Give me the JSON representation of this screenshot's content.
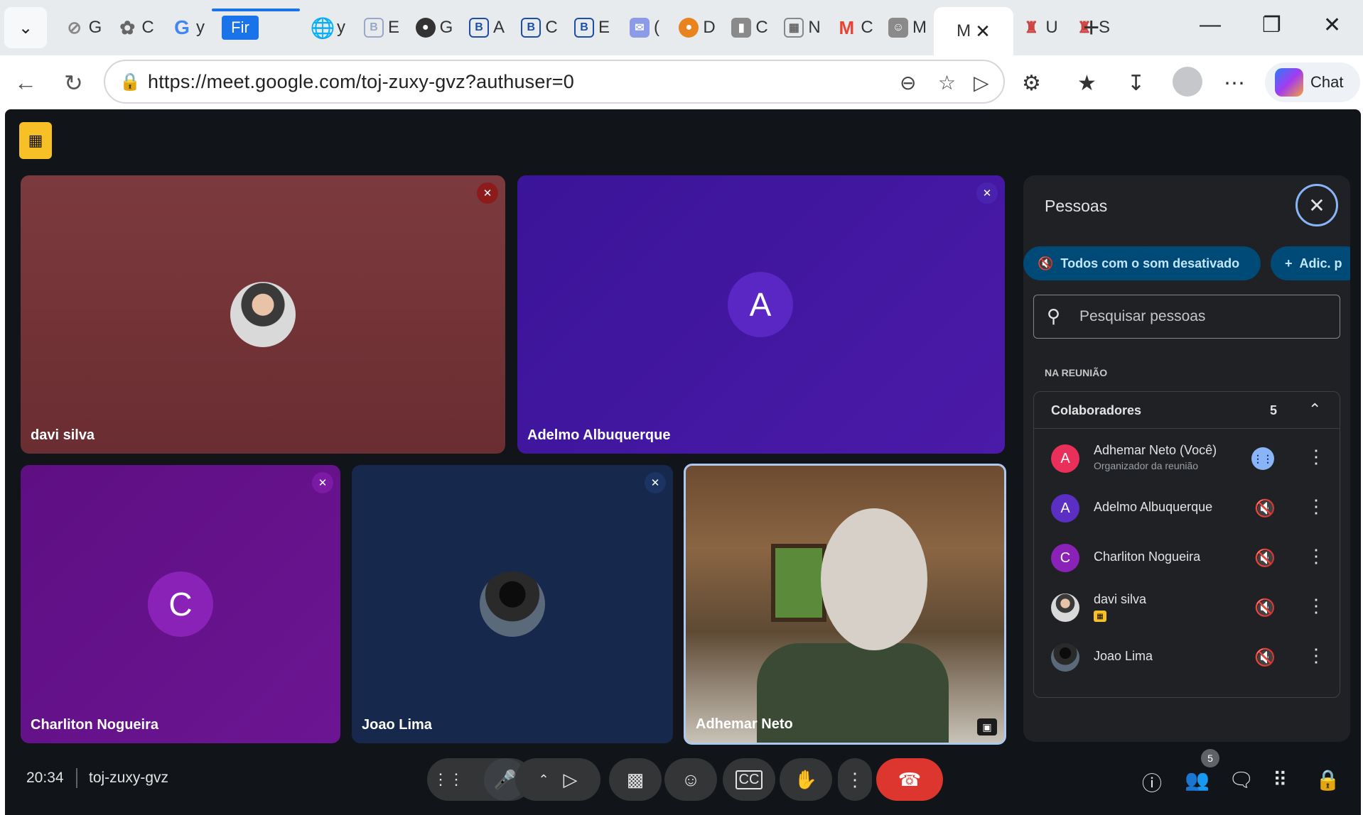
{
  "browser": {
    "tabs": [
      {
        "letter": "G",
        "icon": "feather-icon"
      },
      {
        "letter": "C",
        "icon": "openai-icon"
      },
      {
        "letter": "y",
        "icon": "google-icon"
      },
      {
        "label": "Fir",
        "icon": "fir-icon"
      },
      {
        "letter": "y",
        "icon": "globe-icon"
      },
      {
        "letter": "E",
        "icon": "b-icon"
      },
      {
        "letter": "G",
        "icon": "github-icon"
      },
      {
        "letter": "A",
        "icon": "b-icon"
      },
      {
        "letter": "C",
        "icon": "b-icon"
      },
      {
        "letter": "E",
        "icon": "b-icon"
      },
      {
        "letter": "(",
        "icon": "mail-icon"
      },
      {
        "letter": "D",
        "icon": "metamask-icon"
      },
      {
        "letter": "C",
        "icon": "book-icon"
      },
      {
        "letter": "N",
        "icon": "app-icon"
      },
      {
        "letter": "C",
        "icon": "gmail-icon"
      },
      {
        "letter": "M",
        "icon": "contact-icon"
      },
      {
        "letter": "U",
        "icon": "castle-icon"
      },
      {
        "letter": "S",
        "icon": "castle-icon"
      }
    ],
    "active_tab_letter": "M",
    "url": "https://meet.google.com/toj-zuxy-gvz?authuser=0",
    "chat_label": "Chat"
  },
  "meet": {
    "tiles": [
      {
        "name": "davi silva"
      },
      {
        "name": "Adelmo Albuquerque",
        "initial": "A"
      },
      {
        "name": "Charliton Nogueira",
        "initial": "C"
      },
      {
        "name": "Joao Lima"
      },
      {
        "name": "Adhemar Neto"
      }
    ],
    "panel": {
      "title": "Pessoas",
      "mute_all": "Todos com o som desativado",
      "add": "Adic. p",
      "search_placeholder": "Pesquisar pessoas",
      "section": "NA REUNIÃO",
      "group_title": "Colaboradores",
      "group_count": "5",
      "people": [
        {
          "name": "Adhemar Neto (Você)",
          "sub": "Organizador da reunião",
          "initial": "A",
          "color": "#e8305a"
        },
        {
          "name": "Adelmo Albuquerque",
          "initial": "A",
          "color": "#5b2fc4"
        },
        {
          "name": "Charliton Nogueira",
          "initial": "C",
          "color": "#8a22b8"
        },
        {
          "name": "davi silva"
        },
        {
          "name": "Joao Lima"
        }
      ]
    },
    "clock": "20:34",
    "meeting_code": "toj-zuxy-gvz",
    "people_count": "5",
    "colors": {
      "end_call": "#dc362e",
      "accent": "#8ab4f8",
      "pill": "#004a77"
    }
  }
}
